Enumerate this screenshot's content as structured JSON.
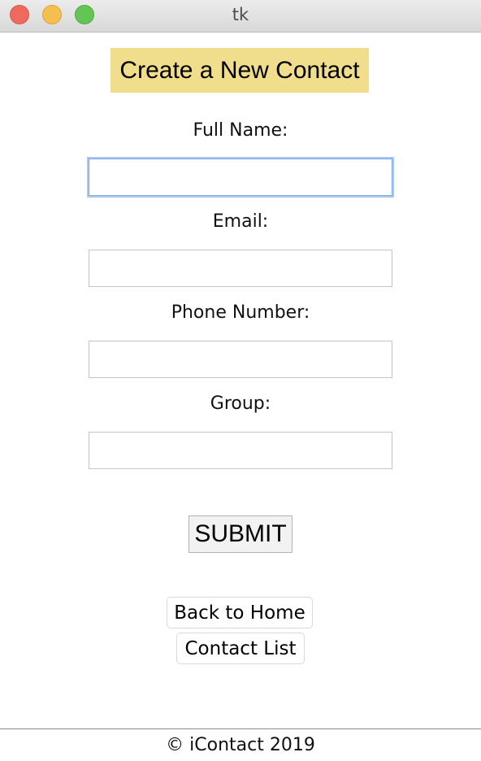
{
  "window": {
    "title": "tk"
  },
  "form": {
    "heading": "Create a New Contact",
    "fields": [
      {
        "label": "Full Name:",
        "value": ""
      },
      {
        "label": "Email:",
        "value": ""
      },
      {
        "label": "Phone Number:",
        "value": ""
      },
      {
        "label": "Group:",
        "value": ""
      }
    ],
    "submit_label": "SUBMIT"
  },
  "nav": {
    "back_home_label": "Back to Home",
    "contact_list_label": "Contact List"
  },
  "footer": {
    "text": "© iContact 2019"
  },
  "colors": {
    "heading_bg": "#f0de8c",
    "focus_ring": "#a9c9f4"
  }
}
